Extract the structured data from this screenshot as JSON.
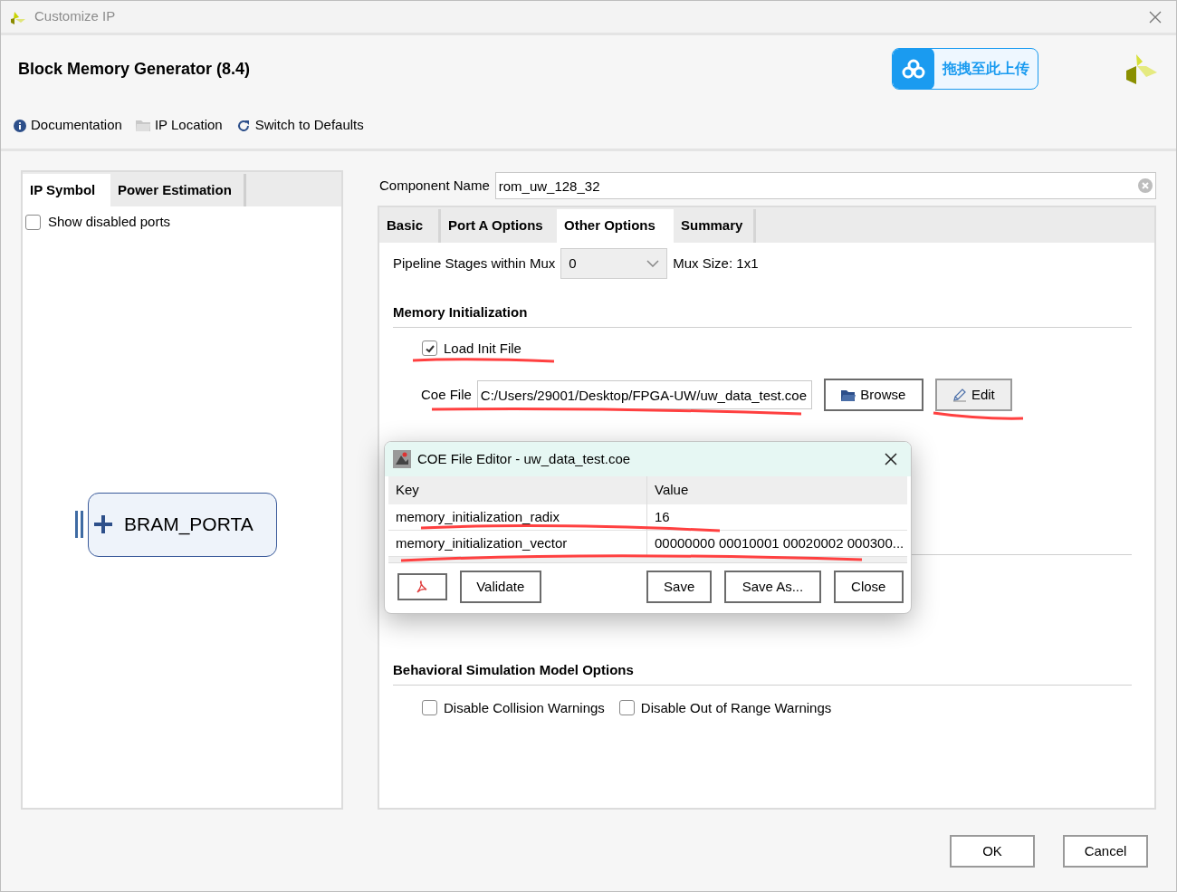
{
  "window": {
    "title": "Customize IP"
  },
  "header": {
    "title": "Block Memory Generator (8.4)",
    "upload_button": "拖拽至此上传"
  },
  "toolbar": [
    {
      "kind": "info",
      "label": "Documentation"
    },
    {
      "kind": "folder",
      "label": "IP Location"
    },
    {
      "kind": "refresh",
      "label": "Switch to Defaults"
    }
  ],
  "left_panel": {
    "tabs": [
      {
        "label": "IP Symbol",
        "selected": true
      },
      {
        "label": "Power Estimation",
        "selected": false
      }
    ],
    "show_disabled_ports": {
      "label": "Show disabled ports",
      "checked": false
    },
    "port": "BRAM_PORTA"
  },
  "component_name": {
    "label": "Component Name",
    "value": "rom_uw_128_32"
  },
  "tabs": [
    {
      "label": "Basic",
      "selected": false
    },
    {
      "label": "Port A Options",
      "selected": false
    },
    {
      "label": "Other Options",
      "selected": true
    },
    {
      "label": "Summary",
      "selected": false
    }
  ],
  "pipeline": {
    "label": "Pipeline Stages within Mux",
    "value": "0",
    "mux_size": "Mux Size: 1x1"
  },
  "memory_initialization": {
    "title": "Memory Initialization",
    "load_init_file": {
      "label": "Load Init File",
      "checked": true
    },
    "coe_file": {
      "label": "Coe File",
      "value": "C:/Users/29001/Desktop/FPGA-UW/uw_data_test.coe"
    },
    "buttons": [
      {
        "kind": "folder",
        "label": "Browse"
      },
      {
        "kind": "pencil",
        "label": "Edit"
      }
    ]
  },
  "behavioral": {
    "title": "Behavioral Simulation Model Options",
    "options": [
      {
        "label": "Disable Collision Warnings",
        "checked": false
      },
      {
        "label": "Disable Out of Range Warnings",
        "checked": false
      }
    ]
  },
  "footer_buttons": [
    "OK",
    "Cancel"
  ],
  "coe_editor": {
    "title": "COE File Editor - uw_data_test.coe",
    "columns": [
      "Key",
      "Value"
    ],
    "rows": [
      {
        "key": "memory_initialization_radix",
        "value": "16"
      },
      {
        "key": "memory_initialization_vector",
        "value": "00000000 00010001 00020002 000300..."
      }
    ],
    "buttons": [
      "Validate",
      "Save",
      "Save As...",
      "Close"
    ]
  }
}
